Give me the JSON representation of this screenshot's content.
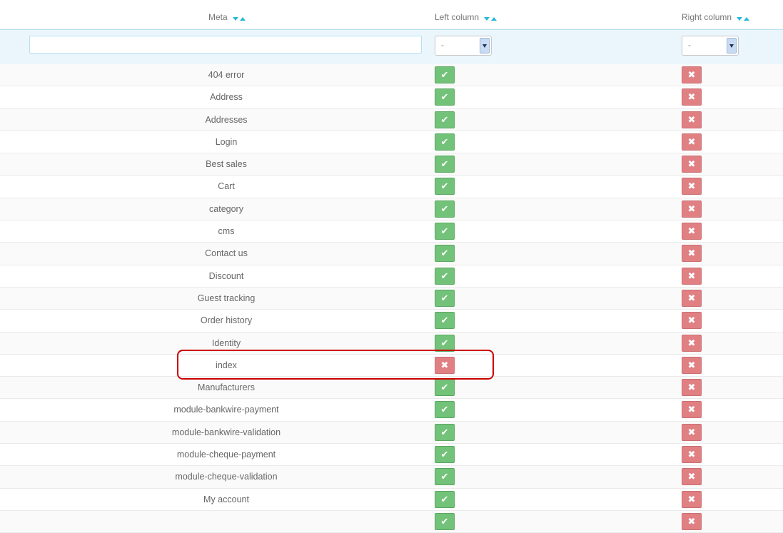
{
  "header": {
    "meta_label": "Meta",
    "left_label": "Left column",
    "right_label": "Right column"
  },
  "filter": {
    "meta_value": "",
    "left_select": "-",
    "right_select": "-"
  },
  "rows": [
    {
      "meta": "404 error",
      "left": "check",
      "right": "cross"
    },
    {
      "meta": "Address",
      "left": "check",
      "right": "cross"
    },
    {
      "meta": "Addresses",
      "left": "check",
      "right": "cross"
    },
    {
      "meta": "Login",
      "left": "check",
      "right": "cross"
    },
    {
      "meta": "Best sales",
      "left": "check",
      "right": "cross"
    },
    {
      "meta": "Cart",
      "left": "check",
      "right": "cross"
    },
    {
      "meta": "category",
      "left": "check",
      "right": "cross"
    },
    {
      "meta": "cms",
      "left": "check",
      "right": "cross"
    },
    {
      "meta": "Contact us",
      "left": "check",
      "right": "cross"
    },
    {
      "meta": "Discount",
      "left": "check",
      "right": "cross"
    },
    {
      "meta": "Guest tracking",
      "left": "check",
      "right": "cross"
    },
    {
      "meta": "Order history",
      "left": "check",
      "right": "cross"
    },
    {
      "meta": "Identity",
      "left": "check",
      "right": "cross"
    },
    {
      "meta": "index",
      "left": "cross",
      "right": "cross"
    },
    {
      "meta": "Manufacturers",
      "left": "check",
      "right": "cross"
    },
    {
      "meta": "module-bankwire-payment",
      "left": "check",
      "right": "cross"
    },
    {
      "meta": "module-bankwire-validation",
      "left": "check",
      "right": "cross"
    },
    {
      "meta": "module-cheque-payment",
      "left": "check",
      "right": "cross"
    },
    {
      "meta": "module-cheque-validation",
      "left": "check",
      "right": "cross"
    },
    {
      "meta": "My account",
      "left": "check",
      "right": "cross"
    },
    {
      "meta": "",
      "left": "check",
      "right": "cross"
    }
  ],
  "colors": {
    "check": "#72c279",
    "cross": "#e08083",
    "accent": "#25b9d7",
    "highlight": "#cc0000"
  }
}
